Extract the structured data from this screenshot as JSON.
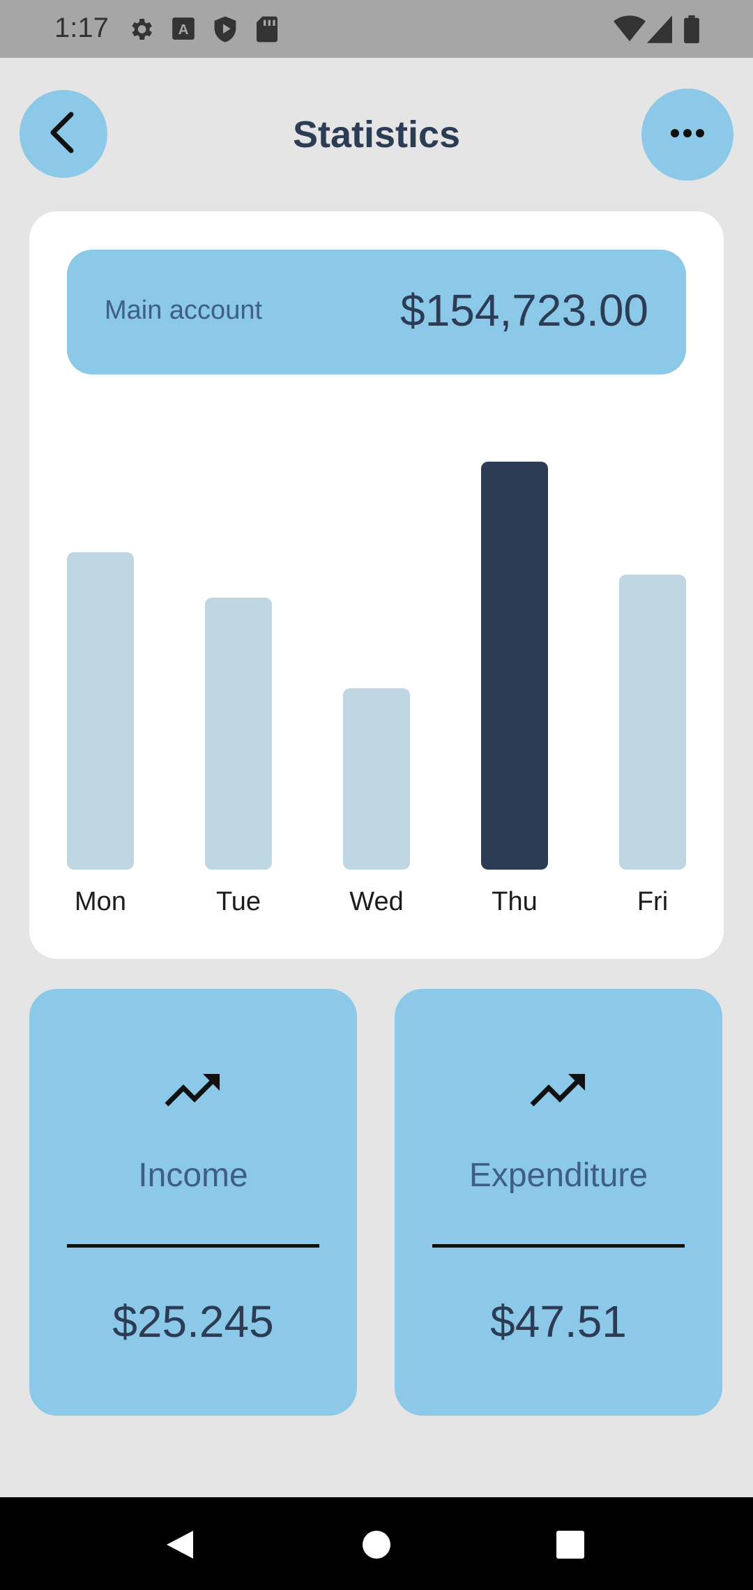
{
  "status_bar": {
    "time": "1:17",
    "icons_left": [
      "gear-icon",
      "font-icon",
      "shield-icon",
      "sd-card-icon"
    ],
    "icons_right": [
      "wifi-icon",
      "signal-icon",
      "battery-icon"
    ]
  },
  "header": {
    "title": "Statistics",
    "back_icon": "chevron-left-icon",
    "menu_icon": "more-horizontal-icon"
  },
  "account": {
    "label": "Main account",
    "amount": "$154,723.00"
  },
  "chart_data": {
    "type": "bar",
    "categories": [
      "Mon",
      "Tue",
      "Wed",
      "Thu",
      "Fri"
    ],
    "values": [
      70,
      60,
      40,
      90,
      65
    ],
    "highlighted_category": "Thu",
    "ylim": [
      0,
      100
    ],
    "grid": false,
    "colors": {
      "bar": "#bfd7e3",
      "highlight": "#2c3c55"
    }
  },
  "stats": {
    "income": {
      "icon": "trending-up-icon",
      "label": "Income",
      "value": "$25.245"
    },
    "expenditure": {
      "icon": "trending-up-icon",
      "label": "Expenditure",
      "value": "$47.51"
    }
  },
  "nav": {
    "icons": [
      "back-triangle-icon",
      "home-circle-icon",
      "recents-square-icon"
    ]
  },
  "colors": {
    "accent": "#8cc8e7",
    "dark": "#2c3c55",
    "label_blue": "#3d5f86",
    "background": "#e5e5e6"
  }
}
